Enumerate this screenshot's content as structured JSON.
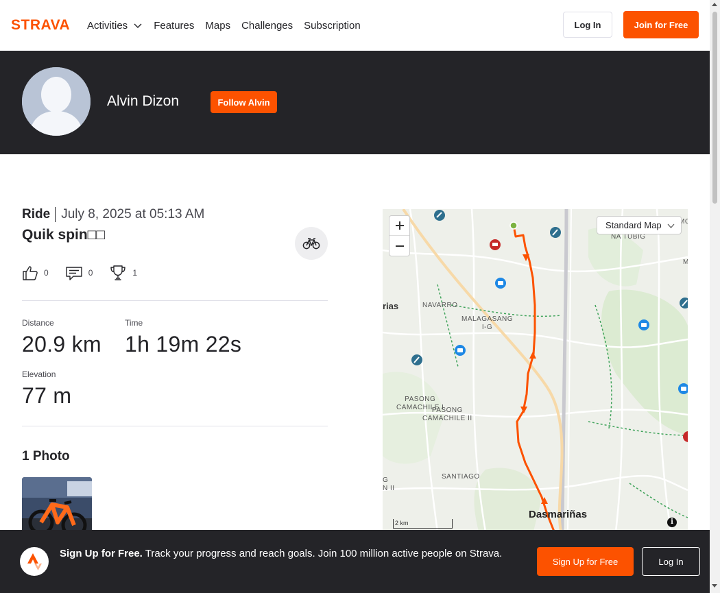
{
  "nav": {
    "logo_text": "STRAVA",
    "links": [
      "Activities",
      "Features",
      "Maps",
      "Challenges",
      "Subscription"
    ],
    "login_label": "Log In",
    "join_label": "Join for Free"
  },
  "athlete": {
    "name": "Alvin Dizon",
    "follow_label": "Follow Alvin"
  },
  "activity": {
    "type": "Ride",
    "date": "July 8, 2025 at 05:13 AM",
    "title": "Quik spin□□",
    "kudos": "0",
    "comments": "0",
    "achievements": "1",
    "stats": {
      "distance_label": "Distance",
      "distance_value": "20.9 km",
      "time_label": "Time",
      "time_value": "1h 19m 22s",
      "elevation_label": "Elevation",
      "elevation_value": "77 m"
    },
    "photos_title": "1 Photo"
  },
  "map": {
    "type_label": "Standard Map",
    "scale_label": "2 km",
    "info_label": "i",
    "labels": {
      "navarro": "NAVARRO",
      "malagasang": "MALAGASANG\nI-G",
      "pasong1": "PASONG\nCAMACHILE I",
      "pasong2": "PASONG\nCAMACHILE II",
      "santiago": "SANTIAGO",
      "dasmarinas": "Dasmariñas",
      "natubig": "NA TUBIG",
      "rias": "rias",
      "g_ii": "G\nN II",
      "m_right": "M",
      "mc_right": "MC"
    },
    "colors": {
      "route": "#fc5200",
      "start": "#7cb342"
    }
  },
  "banner": {
    "headline": "Sign Up for Free.",
    "body": " Track your progress and reach goals. Join 100 million active people on Strava.",
    "signup_label": "Sign Up for Free",
    "login_label": "Log In"
  },
  "brand_color": "#fc5200"
}
